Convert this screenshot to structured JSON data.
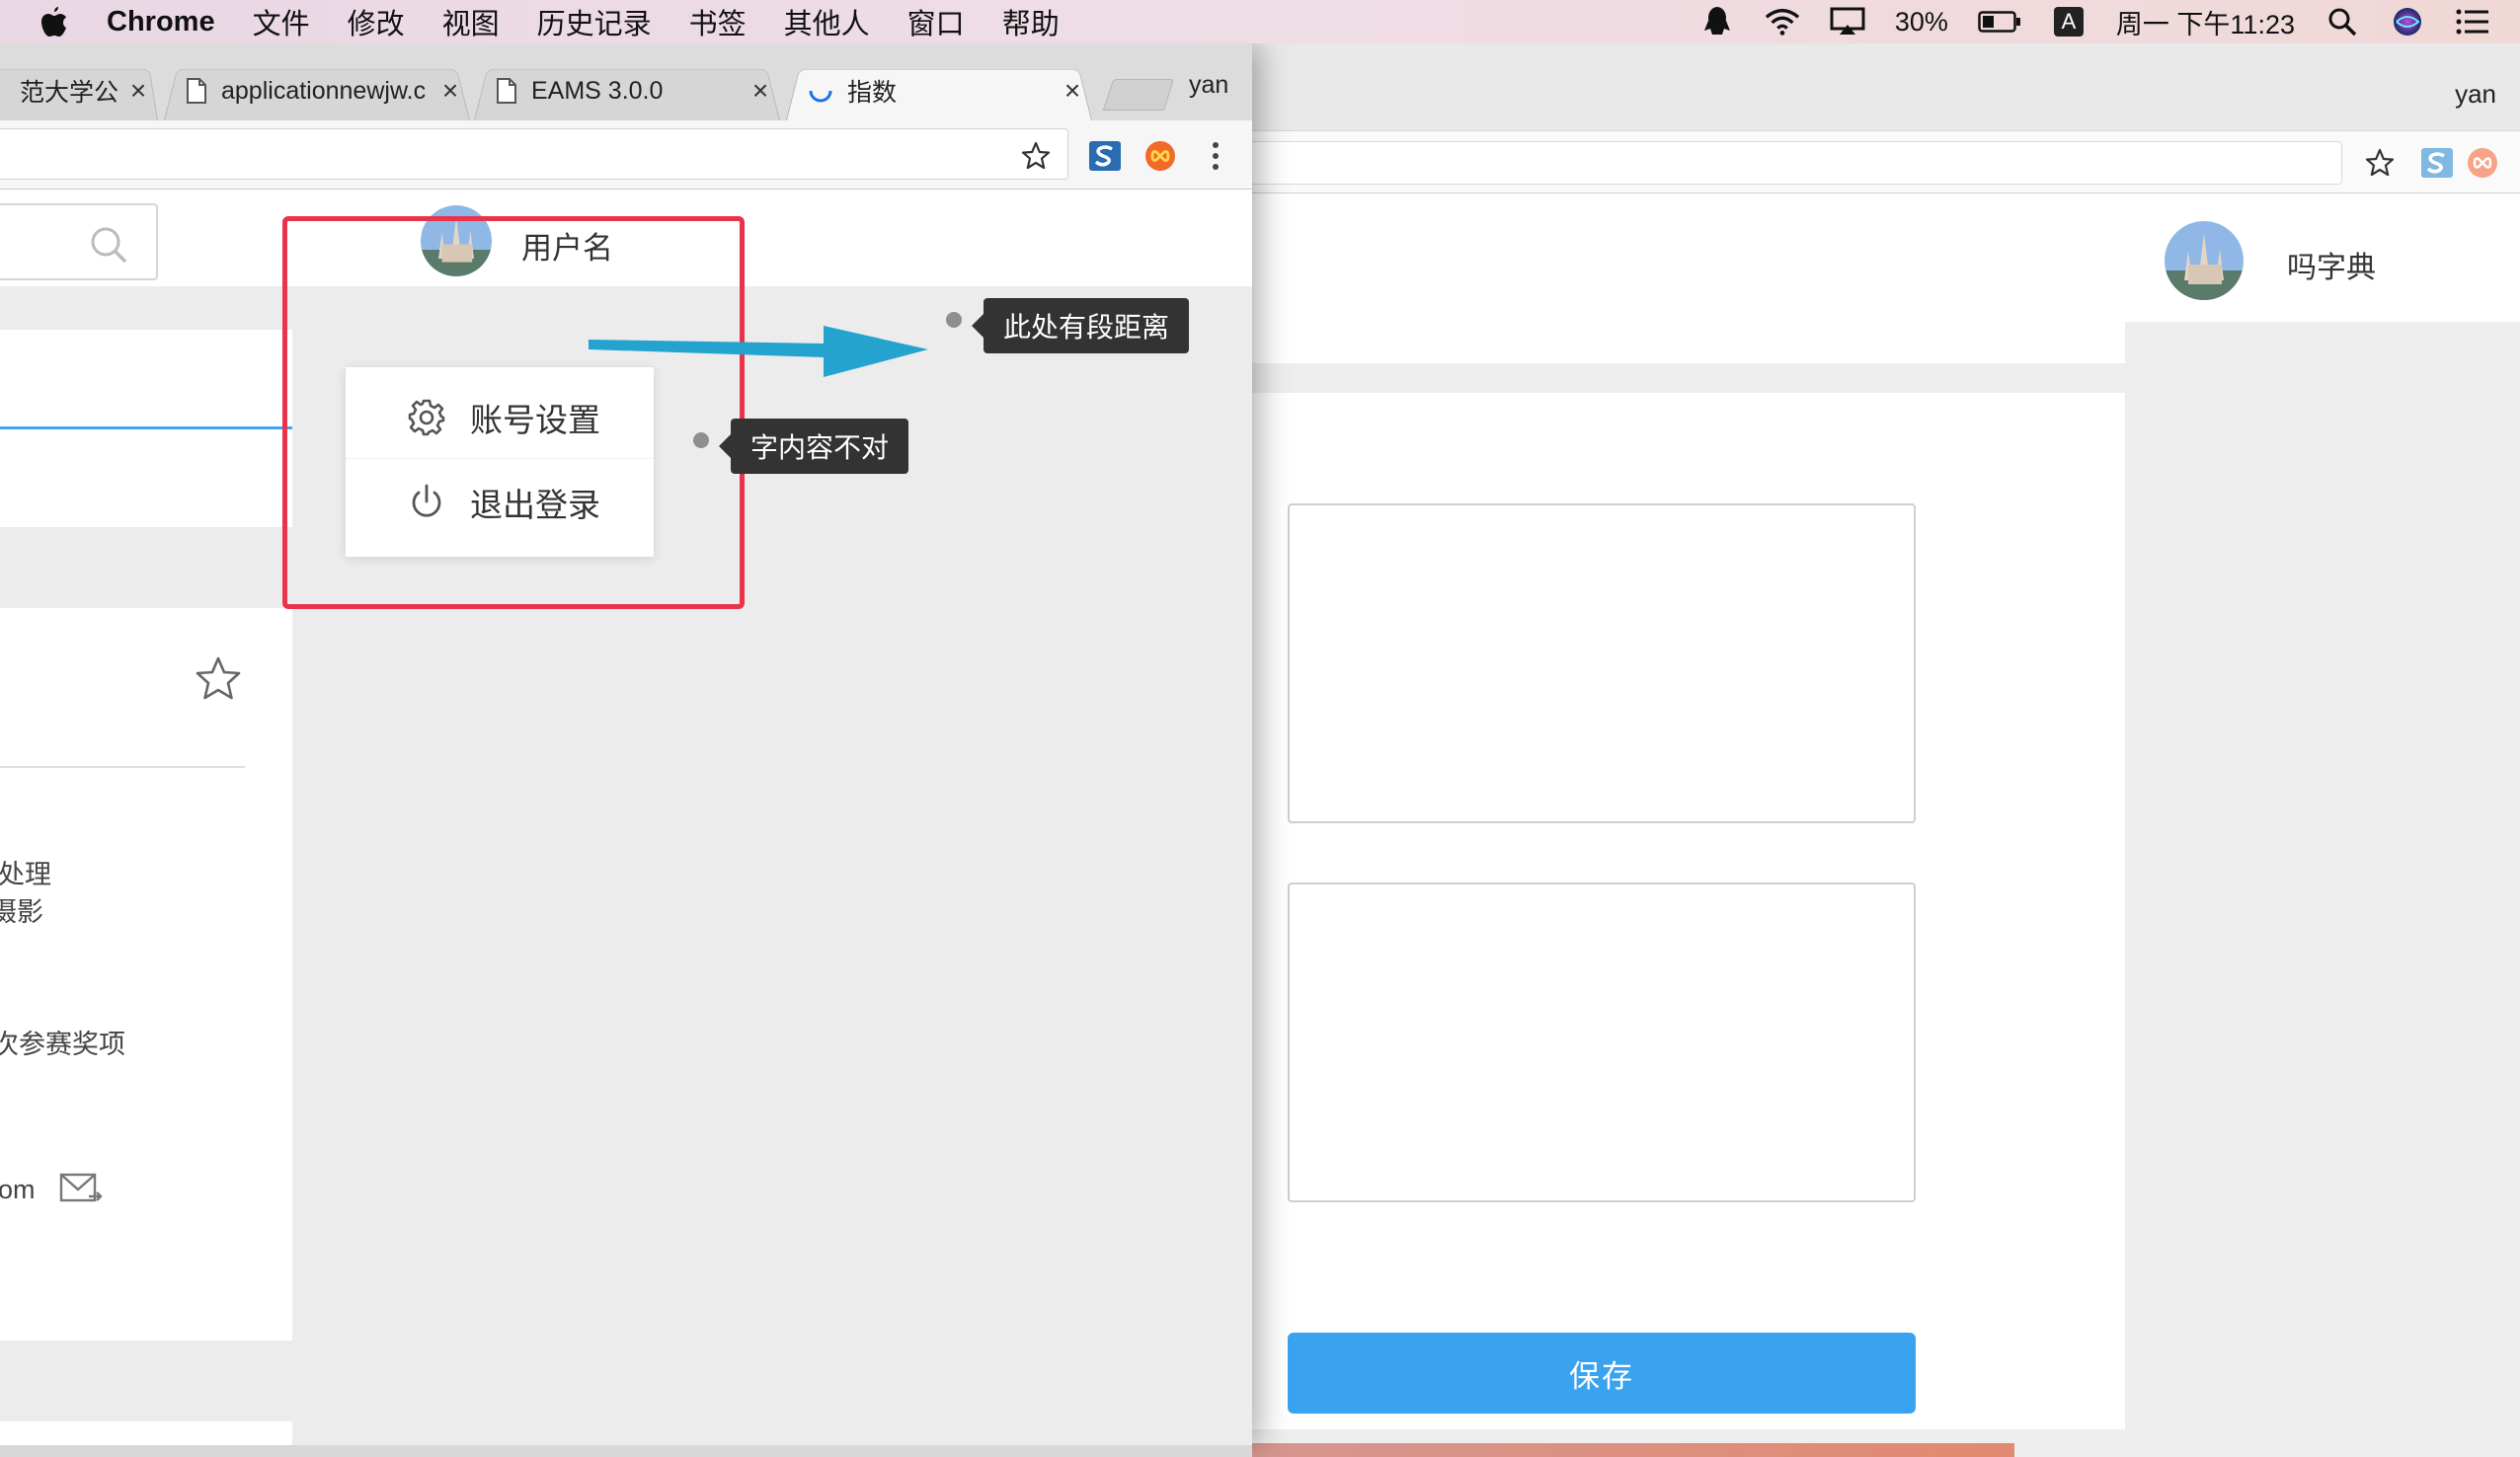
{
  "menubar": {
    "app": "Chrome",
    "items": [
      "文件",
      "修改",
      "视图",
      "历史记录",
      "书签",
      "其他人",
      "窗口",
      "帮助"
    ],
    "battery": "30%",
    "input_method": "A",
    "clock": "周一 下午11:23",
    "icons": [
      "apple-icon",
      "qq-icon",
      "wifi-icon",
      "airplay-icon",
      "battery-icon",
      "input-method-icon",
      "spotlight-icon",
      "siri-icon",
      "notification-center-icon"
    ]
  },
  "front": {
    "tabs": [
      {
        "title": "范大学公共服",
        "active": false
      },
      {
        "title": "applicationnewjw.c",
        "active": false
      },
      {
        "title": "EAMS 3.0.0",
        "active": false
      },
      {
        "title": "指数",
        "active": true
      }
    ],
    "tab_close": "×",
    "profile": "yan",
    "user": {
      "name": "用户名"
    },
    "dropdown": {
      "items": [
        {
          "label": "账号设置",
          "icon": "gear-icon"
        },
        {
          "label": "退出登录",
          "icon": "power-icon"
        }
      ]
    },
    "left": {
      "lines": [
        "处理",
        "摄影",
        "次参赛奖项",
        "om"
      ]
    }
  },
  "annotations": {
    "arrow_note": "此处有段距离",
    "text_note": "字内容不对",
    "highlight_color": "#e8334b",
    "arrow_color": "#24a3cf"
  },
  "back": {
    "profile": "yan",
    "user": {
      "name": "吗字典"
    },
    "save_label": "保存",
    "accent": "#3aa3f0"
  }
}
